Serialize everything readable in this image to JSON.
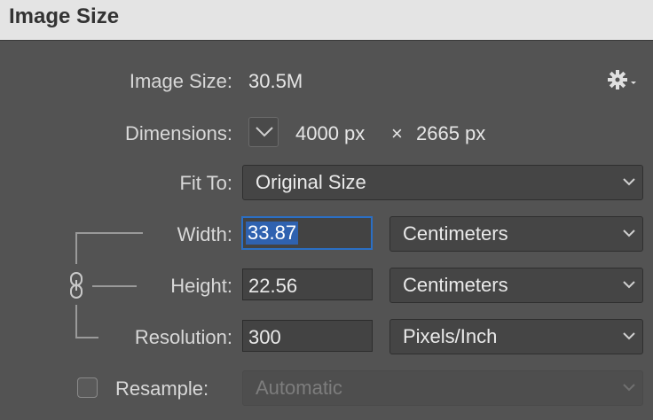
{
  "window": {
    "title": "Image Size"
  },
  "image_size": {
    "label": "Image Size:",
    "value": "30.5M"
  },
  "settings": {
    "icon": "gear-icon"
  },
  "dimensions": {
    "label": "Dimensions:",
    "width": "4000 px",
    "times": "×",
    "height": "2665 px"
  },
  "fit_to": {
    "label": "Fit To:",
    "value": "Original Size"
  },
  "width": {
    "label": "Width:",
    "value": "33.87",
    "unit": "Centimeters"
  },
  "height": {
    "label": "Height:",
    "value": "22.56",
    "unit": "Centimeters"
  },
  "resolution": {
    "label": "Resolution:",
    "value": "300",
    "unit": "Pixels/Inch"
  },
  "resample": {
    "label": "Resample:",
    "checked": false,
    "value": "Automatic"
  },
  "colors": {
    "background": "#535353",
    "titlebar": "#e4e4e4",
    "focus_accent": "#2b6fc4"
  }
}
